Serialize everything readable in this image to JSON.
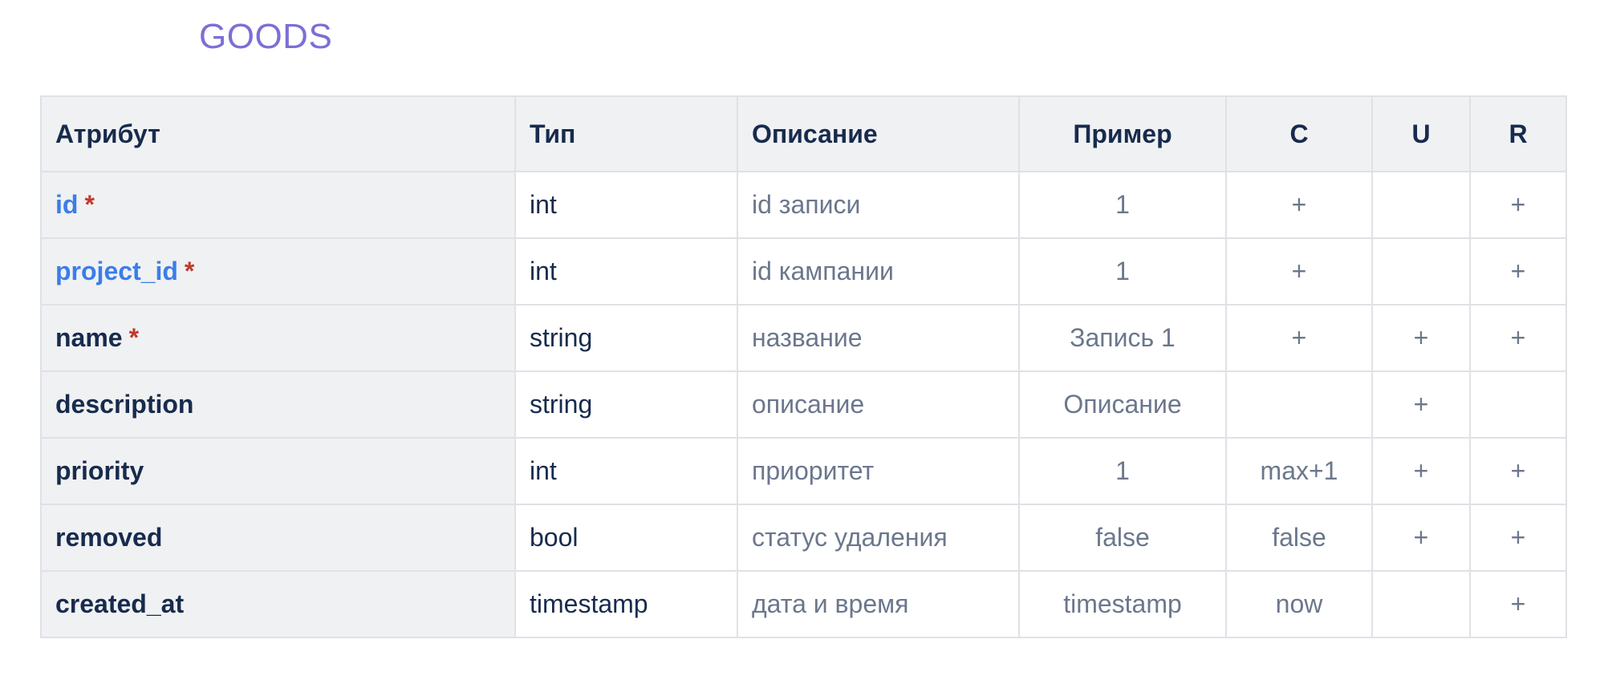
{
  "title": "GOODS",
  "headers": {
    "attribute": "Атрибут",
    "type": "Тип",
    "description": "Описание",
    "example": "Пример",
    "c": "C",
    "u": "U",
    "r": "R"
  },
  "rows": [
    {
      "name": "id",
      "required": "*",
      "link": true,
      "type": "int",
      "description": "id записи",
      "example": "1",
      "c": "+",
      "u": "",
      "r": "+"
    },
    {
      "name": "project_id",
      "required": "*",
      "link": true,
      "type": "int",
      "description": "id кампании",
      "example": "1",
      "c": "+",
      "u": "",
      "r": "+"
    },
    {
      "name": "name",
      "required": "*",
      "link": false,
      "type": "string",
      "description": "название",
      "example": "Запись 1",
      "c": "+",
      "u": "+",
      "r": "+"
    },
    {
      "name": "description",
      "required": "",
      "link": false,
      "type": "string",
      "description": "описание",
      "example": "Описание",
      "c": "",
      "u": "+",
      "r": ""
    },
    {
      "name": "priority",
      "required": "",
      "link": false,
      "type": "int",
      "description": "приоритет",
      "example": "1",
      "c": "max+1",
      "u": "+",
      "r": "+"
    },
    {
      "name": "removed",
      "required": "",
      "link": false,
      "type": "bool",
      "description": "статус удаления",
      "example": "false",
      "c": "false",
      "u": "+",
      "r": "+"
    },
    {
      "name": "created_at",
      "required": "",
      "link": false,
      "type": "timestamp",
      "description": "дата и время",
      "example": "timestamp",
      "c": "now",
      "u": "",
      "r": "+"
    }
  ]
}
